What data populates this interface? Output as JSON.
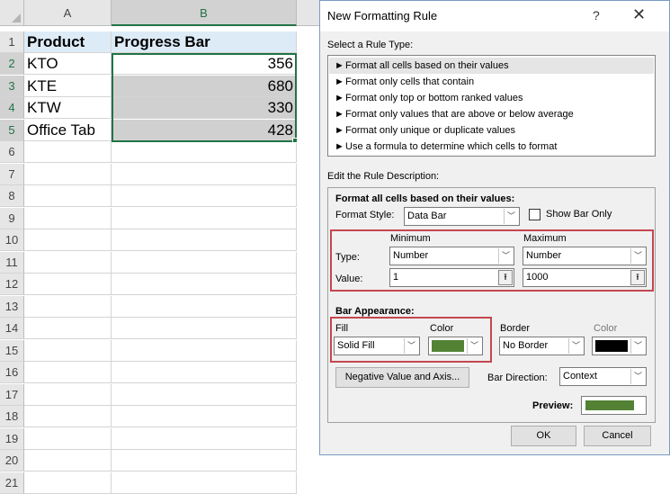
{
  "sheet": {
    "col_a": "A",
    "col_b": "B",
    "row_numbers": [
      "1",
      "2",
      "3",
      "4",
      "5",
      "6",
      "7",
      "8",
      "9",
      "10",
      "11",
      "12",
      "13",
      "14",
      "15",
      "16",
      "17",
      "18",
      "19",
      "20",
      "21"
    ],
    "header_product": "Product",
    "header_progress": "Progress Bar",
    "rows": [
      {
        "product": "KTO",
        "value": "356"
      },
      {
        "product": "KTE",
        "value": "680"
      },
      {
        "product": "KTW",
        "value": "330"
      },
      {
        "product": "Office Tab",
        "value": "428"
      }
    ]
  },
  "dialog": {
    "title": "New Formatting Rule",
    "help": "?",
    "close": "✕",
    "select_rule_type": "Select a Rule Type:",
    "rule_types": [
      "Format all cells based on their values",
      "Format only cells that contain",
      "Format only top or bottom ranked values",
      "Format only values that are above or below average",
      "Format only unique or duplicate values",
      "Use a formula to determine which cells to format"
    ],
    "edit_rule_description": "Edit the Rule Description:",
    "format_all_cells": "Format all cells based on their values:",
    "format_style_label": "Format Style:",
    "format_style_value": "Data Bar",
    "show_bar_only": "Show Bar Only",
    "minimum": "Minimum",
    "maximum": "Maximum",
    "type_label": "Type:",
    "min_type": "Number",
    "max_type": "Number",
    "value_label": "Value:",
    "min_value": "1",
    "max_value": "1000",
    "bar_appearance": "Bar Appearance:",
    "fill_label": "Fill",
    "fill_value": "Solid Fill",
    "color_label": "Color",
    "fill_color": "#548235",
    "border_label": "Border",
    "border_value": "No Border",
    "border_color_label": "Color",
    "border_color": "#000000",
    "negative_button": "Negative Value and Axis...",
    "bar_direction_label": "Bar Direction:",
    "bar_direction_value": "Context",
    "preview_label": "Preview:",
    "preview_color": "#548235",
    "ok": "OK",
    "cancel": "Cancel"
  }
}
